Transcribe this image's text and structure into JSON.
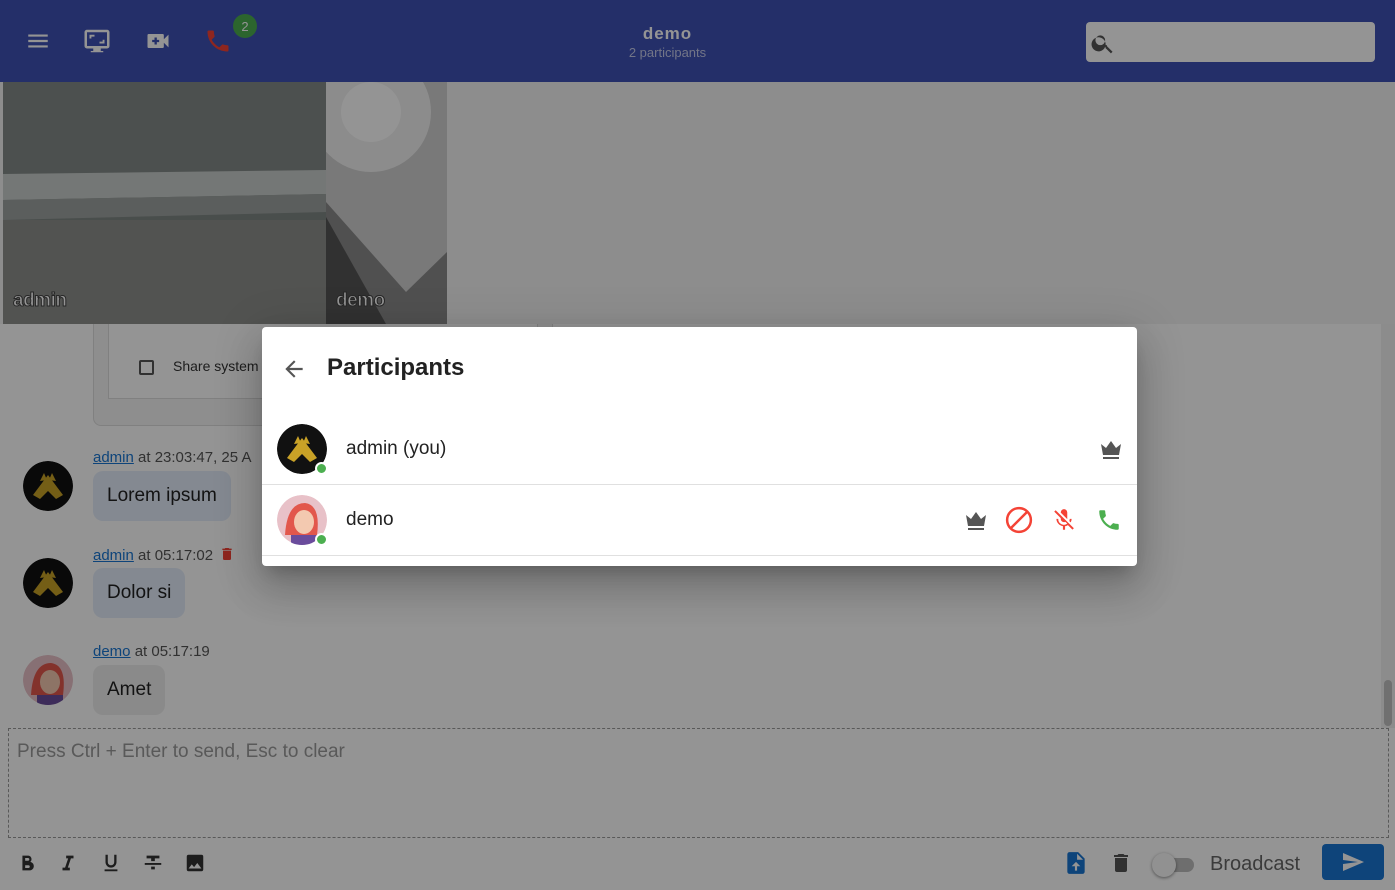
{
  "header": {
    "title": "demo",
    "subtitle": "2 participants",
    "call_badge_count": "2",
    "search": {
      "placeholder": "",
      "value": ""
    },
    "icons": [
      "menu-icon",
      "screen-share-icon",
      "video-call-icon",
      "phone-icon",
      "search-icon"
    ]
  },
  "videos": [
    {
      "label": "admin"
    },
    {
      "label": "demo"
    }
  ],
  "shared_screen_card": {
    "checkbox_label": "Share system au"
  },
  "messages": [
    {
      "author": "admin",
      "time": " at 23:03:47, 25 A",
      "text": "Lorem ipsum"
    },
    {
      "author": "admin",
      "time": " at 05:17:02",
      "text": "Dolor si"
    },
    {
      "author": "demo",
      "time": " at 05:17:19",
      "text": "Amet"
    }
  ],
  "composer": {
    "placeholder": "Press Ctrl + Enter to send, Esc to clear",
    "broadcast_label": "Broadcast",
    "broadcast_enabled": false,
    "format_icons": [
      "bold-icon",
      "italic-icon",
      "underline-icon",
      "strikethrough-icon",
      "image-icon"
    ]
  },
  "dialog": {
    "title": "Participants",
    "participants": [
      {
        "name": "admin (you)",
        "online": true,
        "actions": [
          "crown-icon"
        ]
      },
      {
        "name": "demo",
        "online": true,
        "actions": [
          "crown-icon",
          "ban-icon",
          "mic-off-icon",
          "phone-icon"
        ]
      }
    ]
  },
  "colors": {
    "appbar": "#3f51b5",
    "badge": "#4caf50",
    "danger": "#f44336",
    "success": "#4caf50",
    "send_button": "#1976d2"
  }
}
